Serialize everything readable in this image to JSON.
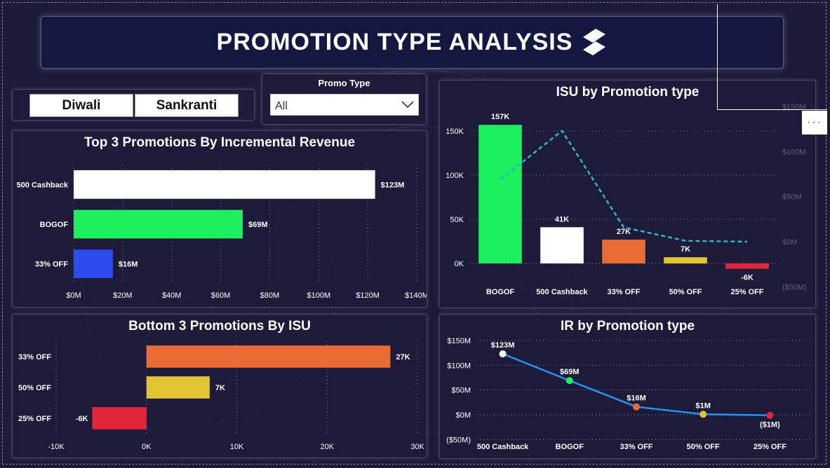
{
  "header": {
    "title": "PROMOTION TYPE ANALYSIS"
  },
  "slicer": {
    "buttons": [
      "Diwali",
      "Sankranti"
    ],
    "promo_label": "Promo Type",
    "promo_value": "All"
  },
  "colors": {
    "white": "#ffffff",
    "green": "#1cf05c",
    "blue": "#2e4cf0",
    "orange": "#e86c34",
    "yellow": "#e2c332",
    "red": "#e4263a",
    "line": "#2296f3",
    "cyan": "#2fb5c4"
  },
  "chart_data": [
    {
      "type": "bar",
      "orientation": "horizontal",
      "title": "Top 3 Promotions By Incremental Revenue",
      "categories": [
        "500 Cashback",
        "BOGOF",
        "33% OFF"
      ],
      "values": [
        123,
        69,
        16
      ],
      "value_labels": [
        "$123M",
        "$69M",
        "$16M"
      ],
      "xlim": [
        0,
        140
      ],
      "xticks": [
        "$0M",
        "$20M",
        "$40M",
        "$60M",
        "$80M",
        "$100M",
        "$120M",
        "$140M"
      ]
    },
    {
      "type": "bar",
      "orientation": "horizontal",
      "title": "Bottom 3 Promotions By ISU",
      "categories": [
        "33% OFF",
        "50% OFF",
        "25% OFF"
      ],
      "values": [
        27,
        7,
        -6
      ],
      "value_labels": [
        "27K",
        "7K",
        "-6K"
      ],
      "xlim": [
        -10,
        30
      ],
      "xticks": [
        "-10K",
        "0K",
        "10K",
        "20K",
        "30K"
      ]
    },
    {
      "type": "bar",
      "title": "ISU by Promotion type",
      "categories": [
        "BOGOF",
        "500 Cashback",
        "33% OFF",
        "50% OFF",
        "25% OFF"
      ],
      "values": [
        157,
        41,
        27,
        7,
        -6
      ],
      "value_labels": [
        "157K",
        "41K",
        "27K",
        "7K",
        "-6K"
      ],
      "ylim": [
        0,
        150
      ],
      "yticks": [
        "0K",
        "50K",
        "100K",
        "150K"
      ],
      "secondary_series": {
        "type": "line",
        "values": [
          69,
          123,
          16,
          1,
          0
        ]
      },
      "y2lim": [
        -50,
        150
      ],
      "y2ticks": [
        "($50M)",
        "$0M",
        "$50M",
        "$100M",
        "$150M"
      ]
    },
    {
      "type": "line",
      "title": "IR by Promotion type",
      "categories": [
        "500 Cashback",
        "BOGOF",
        "33% OFF",
        "50% OFF",
        "25% OFF"
      ],
      "values": [
        123,
        69,
        16,
        1,
        -1
      ],
      "value_labels": [
        "$123M",
        "$69M",
        "$16M",
        "$1M",
        "($1M)"
      ],
      "ylim": [
        -50,
        150
      ],
      "yticks": [
        "($50M)",
        "$0M",
        "$50M",
        "$100M",
        "$150M"
      ]
    }
  ]
}
